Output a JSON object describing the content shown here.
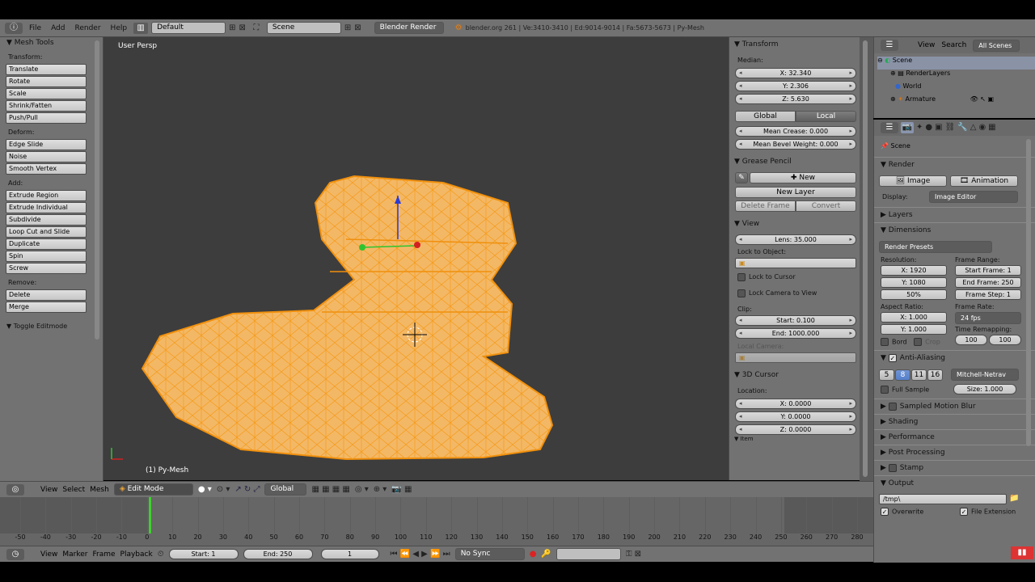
{
  "topbar": {
    "menus": [
      "File",
      "Add",
      "Render",
      "Help"
    ],
    "layout": "Default",
    "scene": "Scene",
    "engine": "Blender Render",
    "stats": "blender.org 261 | Ve:3410-3410 | Ed:9014-9014 | Fa:5673-5673 | Py-Mesh"
  },
  "toolshelf": {
    "title": "Mesh Tools",
    "sections": [
      {
        "label": "Transform:",
        "buttons": [
          "Translate",
          "Rotate",
          "Scale",
          "Shrink/Fatten",
          "Push/Pull"
        ]
      },
      {
        "label": "Deform:",
        "buttons": [
          "Edge Slide",
          "Noise",
          "Smooth Vertex"
        ]
      },
      {
        "label": "Add:",
        "buttons": [
          "Extrude Region",
          "Extrude Individual",
          "Subdivide",
          "Loop Cut and Slide",
          "Duplicate",
          "Spin",
          "Screw"
        ]
      },
      {
        "label": "Remove:",
        "buttons": [
          "Delete",
          "Merge"
        ]
      }
    ],
    "toggle": "Toggle Editmode"
  },
  "viewport": {
    "persp": "User Persp",
    "object": "(1) Py-Mesh"
  },
  "npanel": {
    "transform_title": "Transform",
    "median_label": "Median:",
    "x": "X: 32.340",
    "y": "Y: 2.306",
    "z": "Z: 5.630",
    "global": "Global",
    "local": "Local",
    "crease": "Mean Crease: 0.000",
    "bevel": "Mean Bevel Weight: 0.000",
    "grease_title": "Grease Pencil",
    "new": "New",
    "new_layer": "New Layer",
    "delete_frame": "Delete Frame",
    "convert": "Convert",
    "view_title": "View",
    "lens": "Lens: 35.000",
    "lock_obj": "Lock to Object:",
    "lock_cursor": "Lock to Cursor",
    "lock_camera": "Lock Camera to View",
    "clip": "Clip:",
    "start": "Start: 0.100",
    "end": "End: 1000.000",
    "local_camera": "Local Camera:",
    "cursor_title": "3D Cursor",
    "location": "Location:",
    "cx": "X: 0.0000",
    "cy": "Y: 0.0000",
    "cz": "Z: 0.0000",
    "item": "Item"
  },
  "outliner": {
    "view": "View",
    "search": "Search",
    "scenes": "All Scenes",
    "items": [
      "Scene",
      "RenderLayers",
      "World",
      "Armature"
    ]
  },
  "props": {
    "scene": "Scene",
    "render": "Render",
    "image": "Image",
    "animation": "Animation",
    "display_label": "Display:",
    "display": "Image Editor",
    "layers": "Layers",
    "dimensions": "Dimensions",
    "presets": "Render Presets",
    "resolution": "Resolution:",
    "rx": "X: 1920",
    "ry": "Y: 1080",
    "pct": "50%",
    "frame_range": "Frame Range:",
    "fstart": "Start Frame: 1",
    "fend": "End Frame: 250",
    "fstep": "Frame Step: 1",
    "aspect": "Aspect Ratio:",
    "ax": "X: 1.000",
    "ay": "Y: 1.000",
    "frame_rate": "Frame Rate:",
    "fps": "24 fps",
    "bord": "Bord",
    "crop": "Crop",
    "remap": "Time Remapping:",
    "r1": "100",
    "r2": "100",
    "aa": "Anti-Aliasing",
    "aa_vals": [
      "5",
      "8",
      "11",
      "16"
    ],
    "filter": "Mitchell-Netrav",
    "full_sample": "Full Sample",
    "size": "Size: 1.000",
    "motion_blur": "Sampled Motion Blur",
    "shading": "Shading",
    "performance": "Performance",
    "post": "Post Processing",
    "stamp": "Stamp",
    "output": "Output",
    "path": "/tmp\\",
    "overwrite": "Overwrite",
    "file_ext": "File Extension"
  },
  "vheader": {
    "view": "View",
    "select": "Select",
    "mesh": "Mesh",
    "mode": "Edit Mode",
    "orient": "Global"
  },
  "timeline": {
    "ticks": [
      "-50",
      "-40",
      "-30",
      "-20",
      "-10",
      "0",
      "10",
      "20",
      "30",
      "40",
      "50",
      "60",
      "70",
      "80",
      "90",
      "100",
      "110",
      "120",
      "130",
      "140",
      "150",
      "160",
      "170",
      "180",
      "190",
      "200",
      "210",
      "220",
      "230",
      "240",
      "250",
      "260",
      "270",
      "280"
    ]
  },
  "tlheader": {
    "view": "View",
    "marker": "Marker",
    "frame": "Frame",
    "playback": "Playback",
    "start": "Start: 1",
    "end": "End: 250",
    "current": "1",
    "sync": "No Sync"
  }
}
